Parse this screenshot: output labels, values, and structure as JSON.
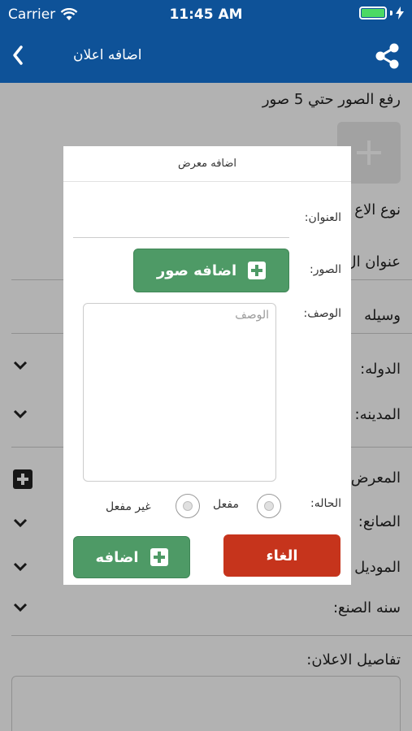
{
  "status_bar": {
    "carrier": "Carrier",
    "time": "11:45 AM"
  },
  "navbar": {
    "title": "اضافه اعلان",
    "back_icon": "chevron-left-icon",
    "share_icon": "share-icon"
  },
  "form": {
    "upload_label": "رفع الصور حتي 5 صور",
    "ad_type_label": "نوع الاع",
    "ad_title_label": "عنوان ال",
    "contact_label": "وسيله",
    "country_label": "الدوله:",
    "city_label": "المدينه:",
    "showroom_label": "المعرض",
    "maker_label": "الصانع:",
    "model_label": "الموديل",
    "year_label": "سنه الصنع:",
    "details_label": "تفاصيل الاعلان:"
  },
  "dialog": {
    "title": "اضافه معرض",
    "title_label": "العنوان:",
    "title_value": "",
    "images_label": "الصور:",
    "add_images_button": "اضافه صور",
    "description_label": "الوصف:",
    "description_placeholder": "الوصف",
    "status_label": "الحاله:",
    "status_options": [
      "مفعل",
      "غير مفعل"
    ],
    "cancel_button": "الغاء",
    "add_button": "اضافه"
  },
  "colors": {
    "navbar": "#0e5298",
    "green": "#4e9a66",
    "cancel": "#c6341c"
  }
}
